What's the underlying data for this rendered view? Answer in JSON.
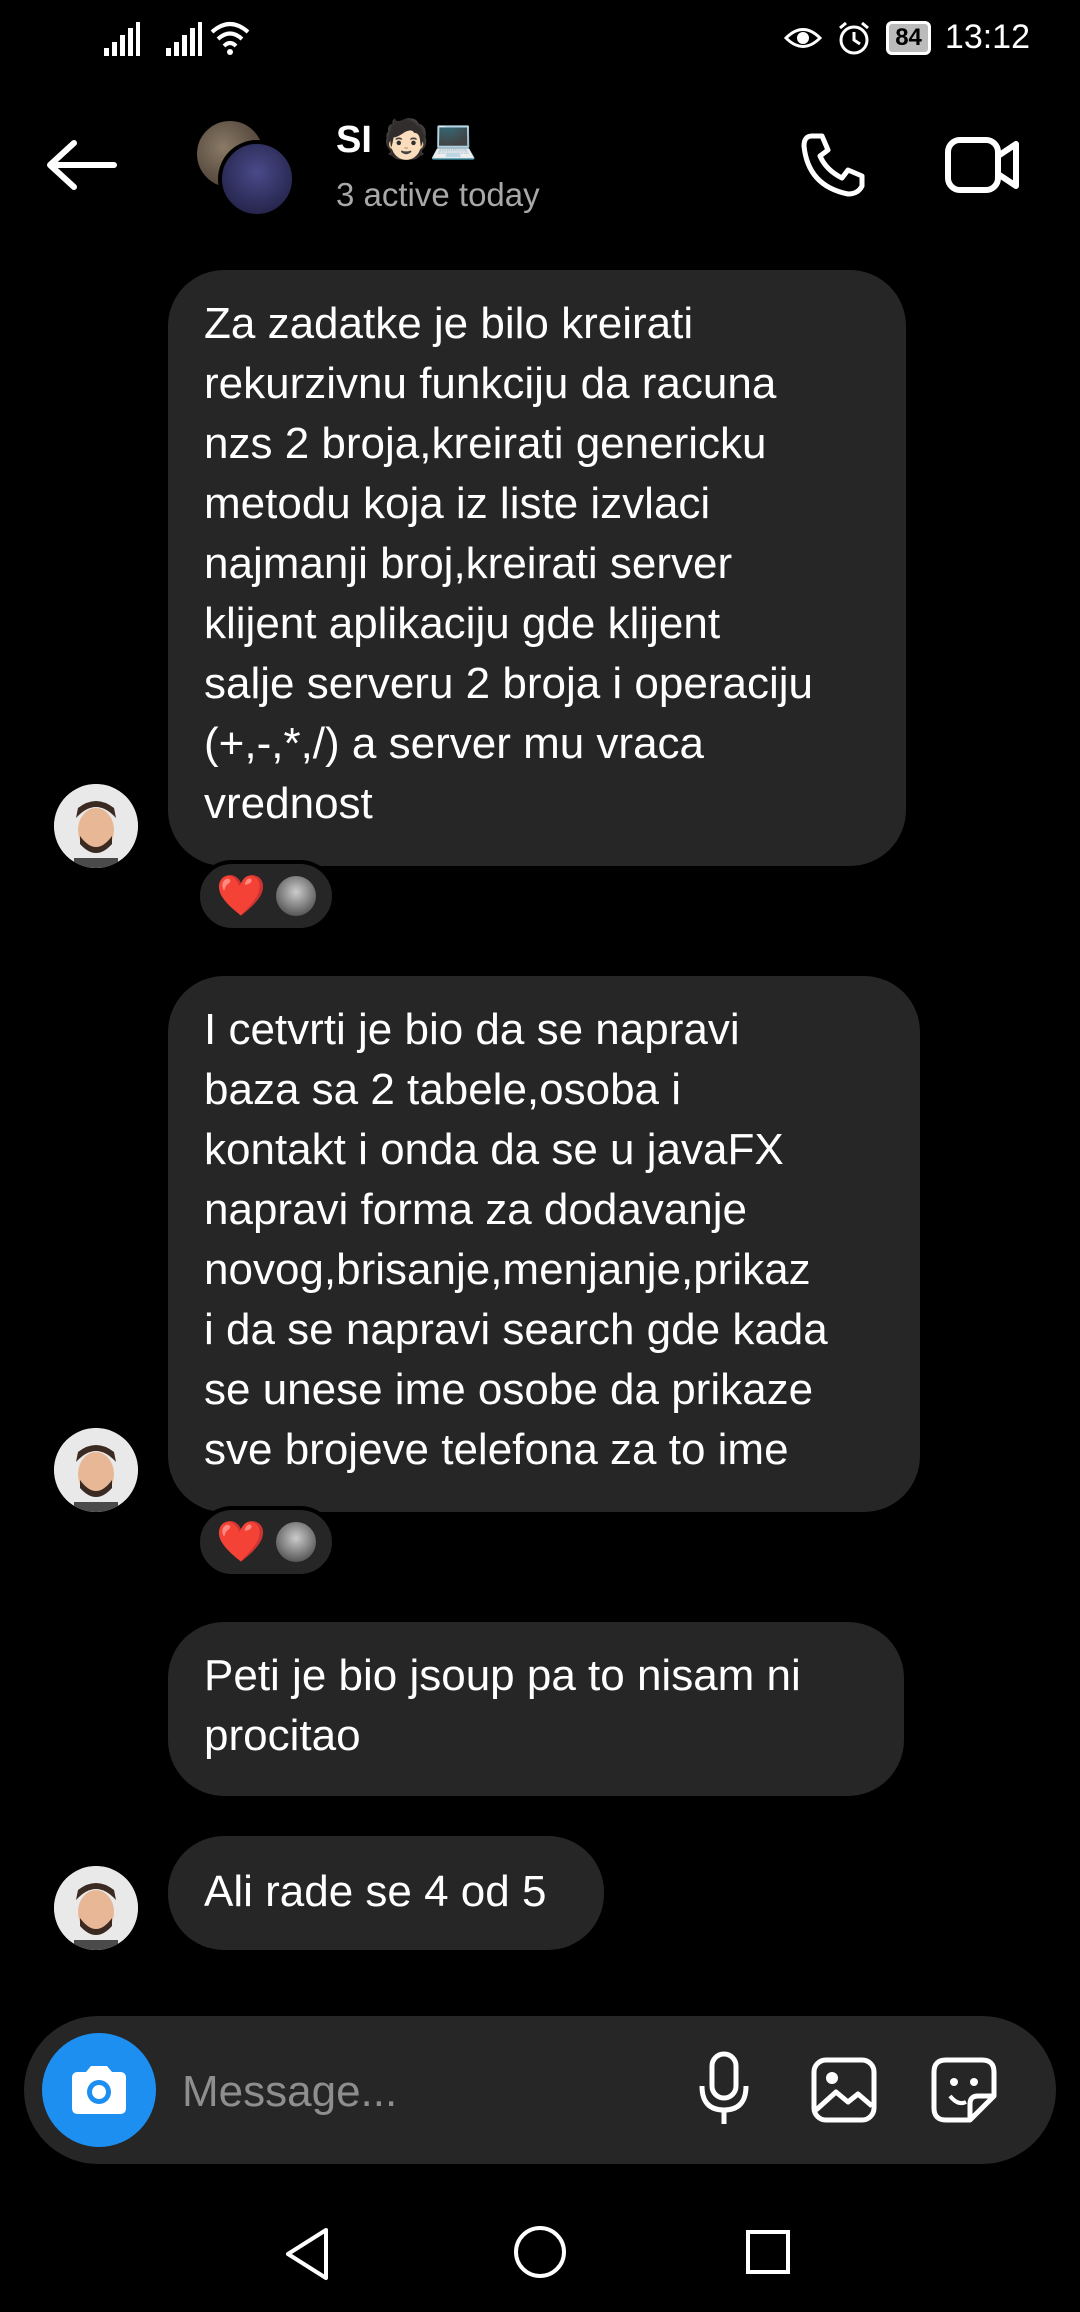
{
  "status": {
    "time": "13:12",
    "battery": "84",
    "icons": [
      "signal-icon",
      "signal-icon",
      "wifi-icon",
      "eye-icon",
      "alarm-icon",
      "battery-icon"
    ]
  },
  "header": {
    "title": "SI 🧑🏻💻",
    "subtitle": "3 active today",
    "icons": [
      "back-arrow-icon",
      "phone-icon",
      "video-camera-icon"
    ]
  },
  "messages": [
    {
      "text": "Za zadatke je bilo kreirati\nrekurzivnu funkciju da racuna\nnzs 2 broja,kreirati genericku\nmetodu koja iz liste izvlaci\nnajmanji broj,kreirati server\nklijent aplikaciju gde klijent\nsalje serveru 2 broja i operaciju\n(+,-,*,/) a server mu vraca\nvrednost",
      "reaction": "❤️"
    },
    {
      "text": "I cetvrti je bio da se napravi\nbaza sa 2 tabele,osoba i\nkontakt i onda da se u javaFX\nnapravi forma za dodavanje\nnovog,brisanje,menjanje,prikaz\ni da se napravi search gde kada\nse unese ime osobe da prikaze\nsve brojeve telefona za to ime",
      "reaction": "❤️"
    },
    {
      "text": "Peti je bio jsoup pa to nisam ni\nprocitao"
    },
    {
      "text": "Ali rade se 4 od 5"
    }
  ],
  "composer": {
    "placeholder": "Message...",
    "icons": [
      "camera-icon",
      "microphone-icon",
      "gallery-icon",
      "sticker-icon"
    ]
  },
  "navbar": {
    "icons": [
      "nav-back-icon",
      "nav-home-icon",
      "nav-recents-icon"
    ]
  }
}
